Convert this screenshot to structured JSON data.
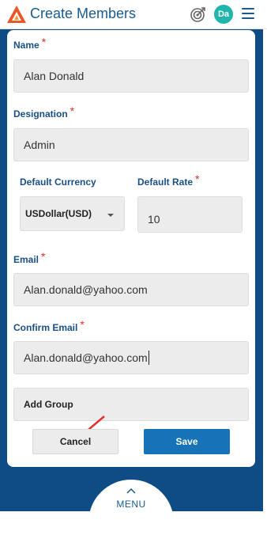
{
  "header": {
    "title": "Create Members",
    "avatar_initials": "Da"
  },
  "form": {
    "name": {
      "label": "Name",
      "value": "Alan Donald"
    },
    "designation": {
      "label": "Designation",
      "value": "Admin"
    },
    "default_currency": {
      "label": "Default Currency",
      "value": "USDollar(USD)"
    },
    "default_rate": {
      "label": "Default Rate",
      "value": "10"
    },
    "email": {
      "label": "Email",
      "value": "Alan.donald@yahoo.com"
    },
    "confirm_email": {
      "label": "Confirm Email",
      "value": "Alan.donald@yahoo.com"
    },
    "add_group": {
      "label": "Add Group"
    },
    "required_marker": "*"
  },
  "actions": {
    "cancel_label": "Cancel",
    "save_label": "Save"
  },
  "bottom": {
    "menu_label": "MENU"
  },
  "colors": {
    "brand_blue": "#1a5b8f",
    "backdrop": "#0f4c86",
    "save_button": "#1772b7",
    "required": "#e0302b",
    "avatar": "#1fb5ad"
  }
}
